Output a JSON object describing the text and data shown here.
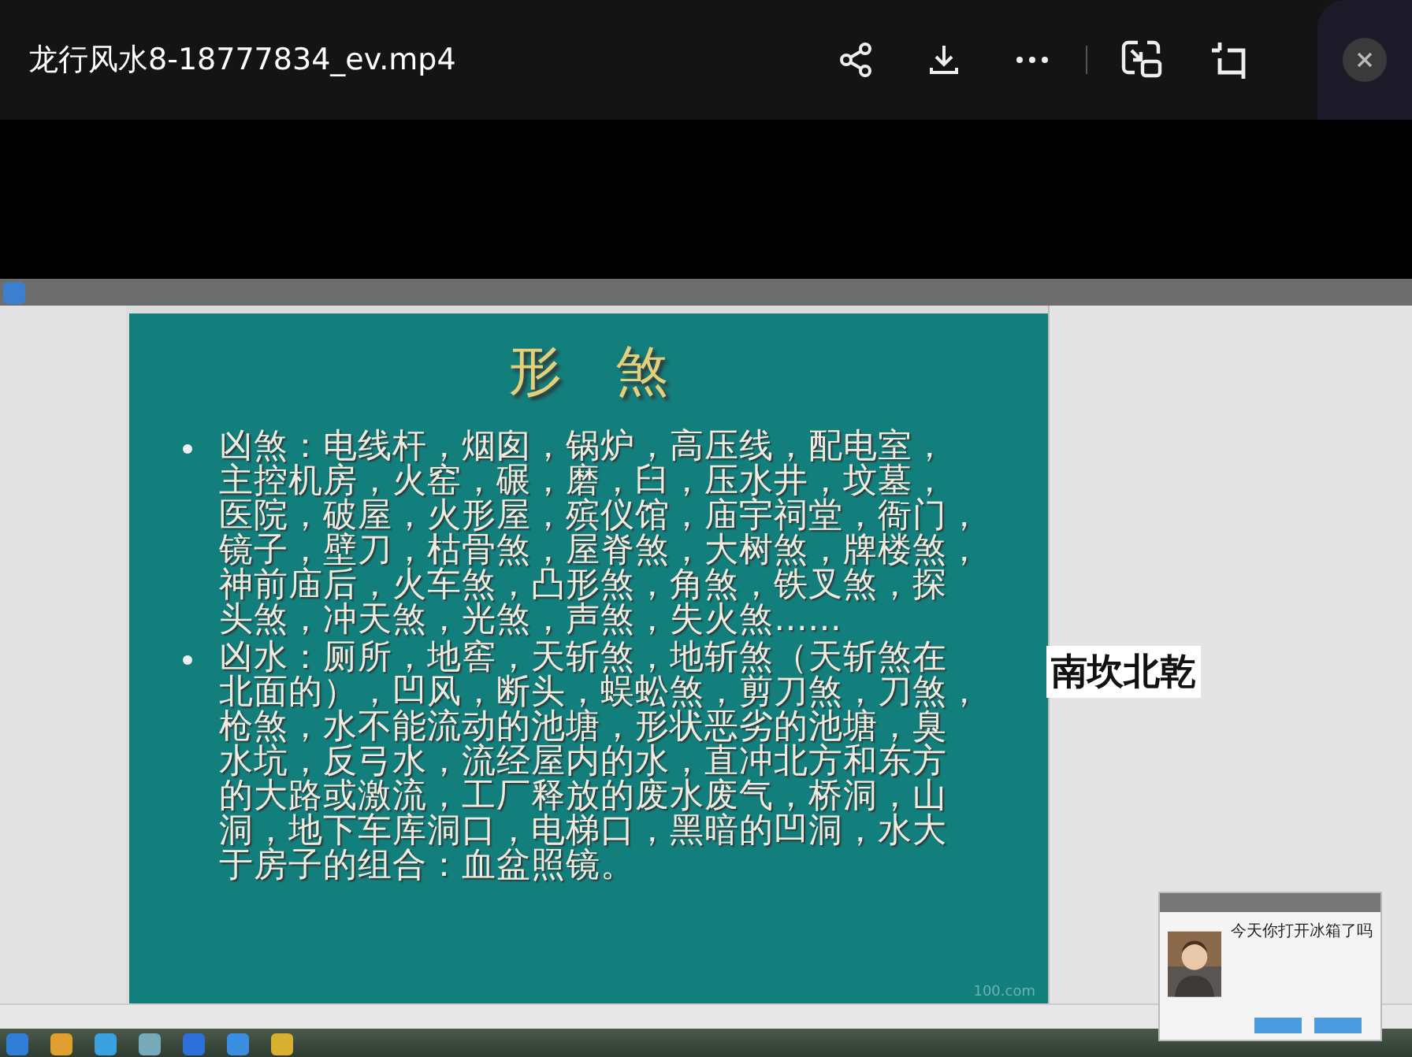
{
  "window": {
    "title": "龙行风水8-18777834_ev.mp4"
  },
  "slide": {
    "title": "形　煞",
    "bullets": [
      {
        "lines": [
          "凶煞：电线杆，烟囱，锅炉，高压线，配电室，",
          "主控机房，火窑，碾，磨，臼，压水井，坟墓，",
          "医院，破屋，火形屋，殡仪馆，庙宇祠堂，衙门，",
          "镜子，壁刀，枯骨煞，屋脊煞，大树煞，牌楼煞，",
          "神前庙后，火车煞，凸形煞，角煞，铁叉煞，探",
          "头煞，冲天煞，光煞，声煞，失火煞……"
        ]
      },
      {
        "lines": [
          "凶水：厕所，地窖，天斩煞，地斩煞（天斩煞在",
          "北面的），凹风，断头，蜈蚣煞，剪刀煞，刀煞，",
          "枪煞，水不能流动的池塘，形状恶劣的池塘，臭",
          "水坑，反弓水，流经屋内的水，直冲北方和东方",
          "的大路或激流，工厂释放的废水废气，桥洞，山",
          "洞，地下车库洞口，电梯口，黑暗的凹洞，水大",
          "于房子的组合：血盆照镜。"
        ]
      }
    ],
    "footer": "100.com"
  },
  "caption": "南坎北乾",
  "popup": {
    "headline": "今天你打开冰箱了吗"
  }
}
